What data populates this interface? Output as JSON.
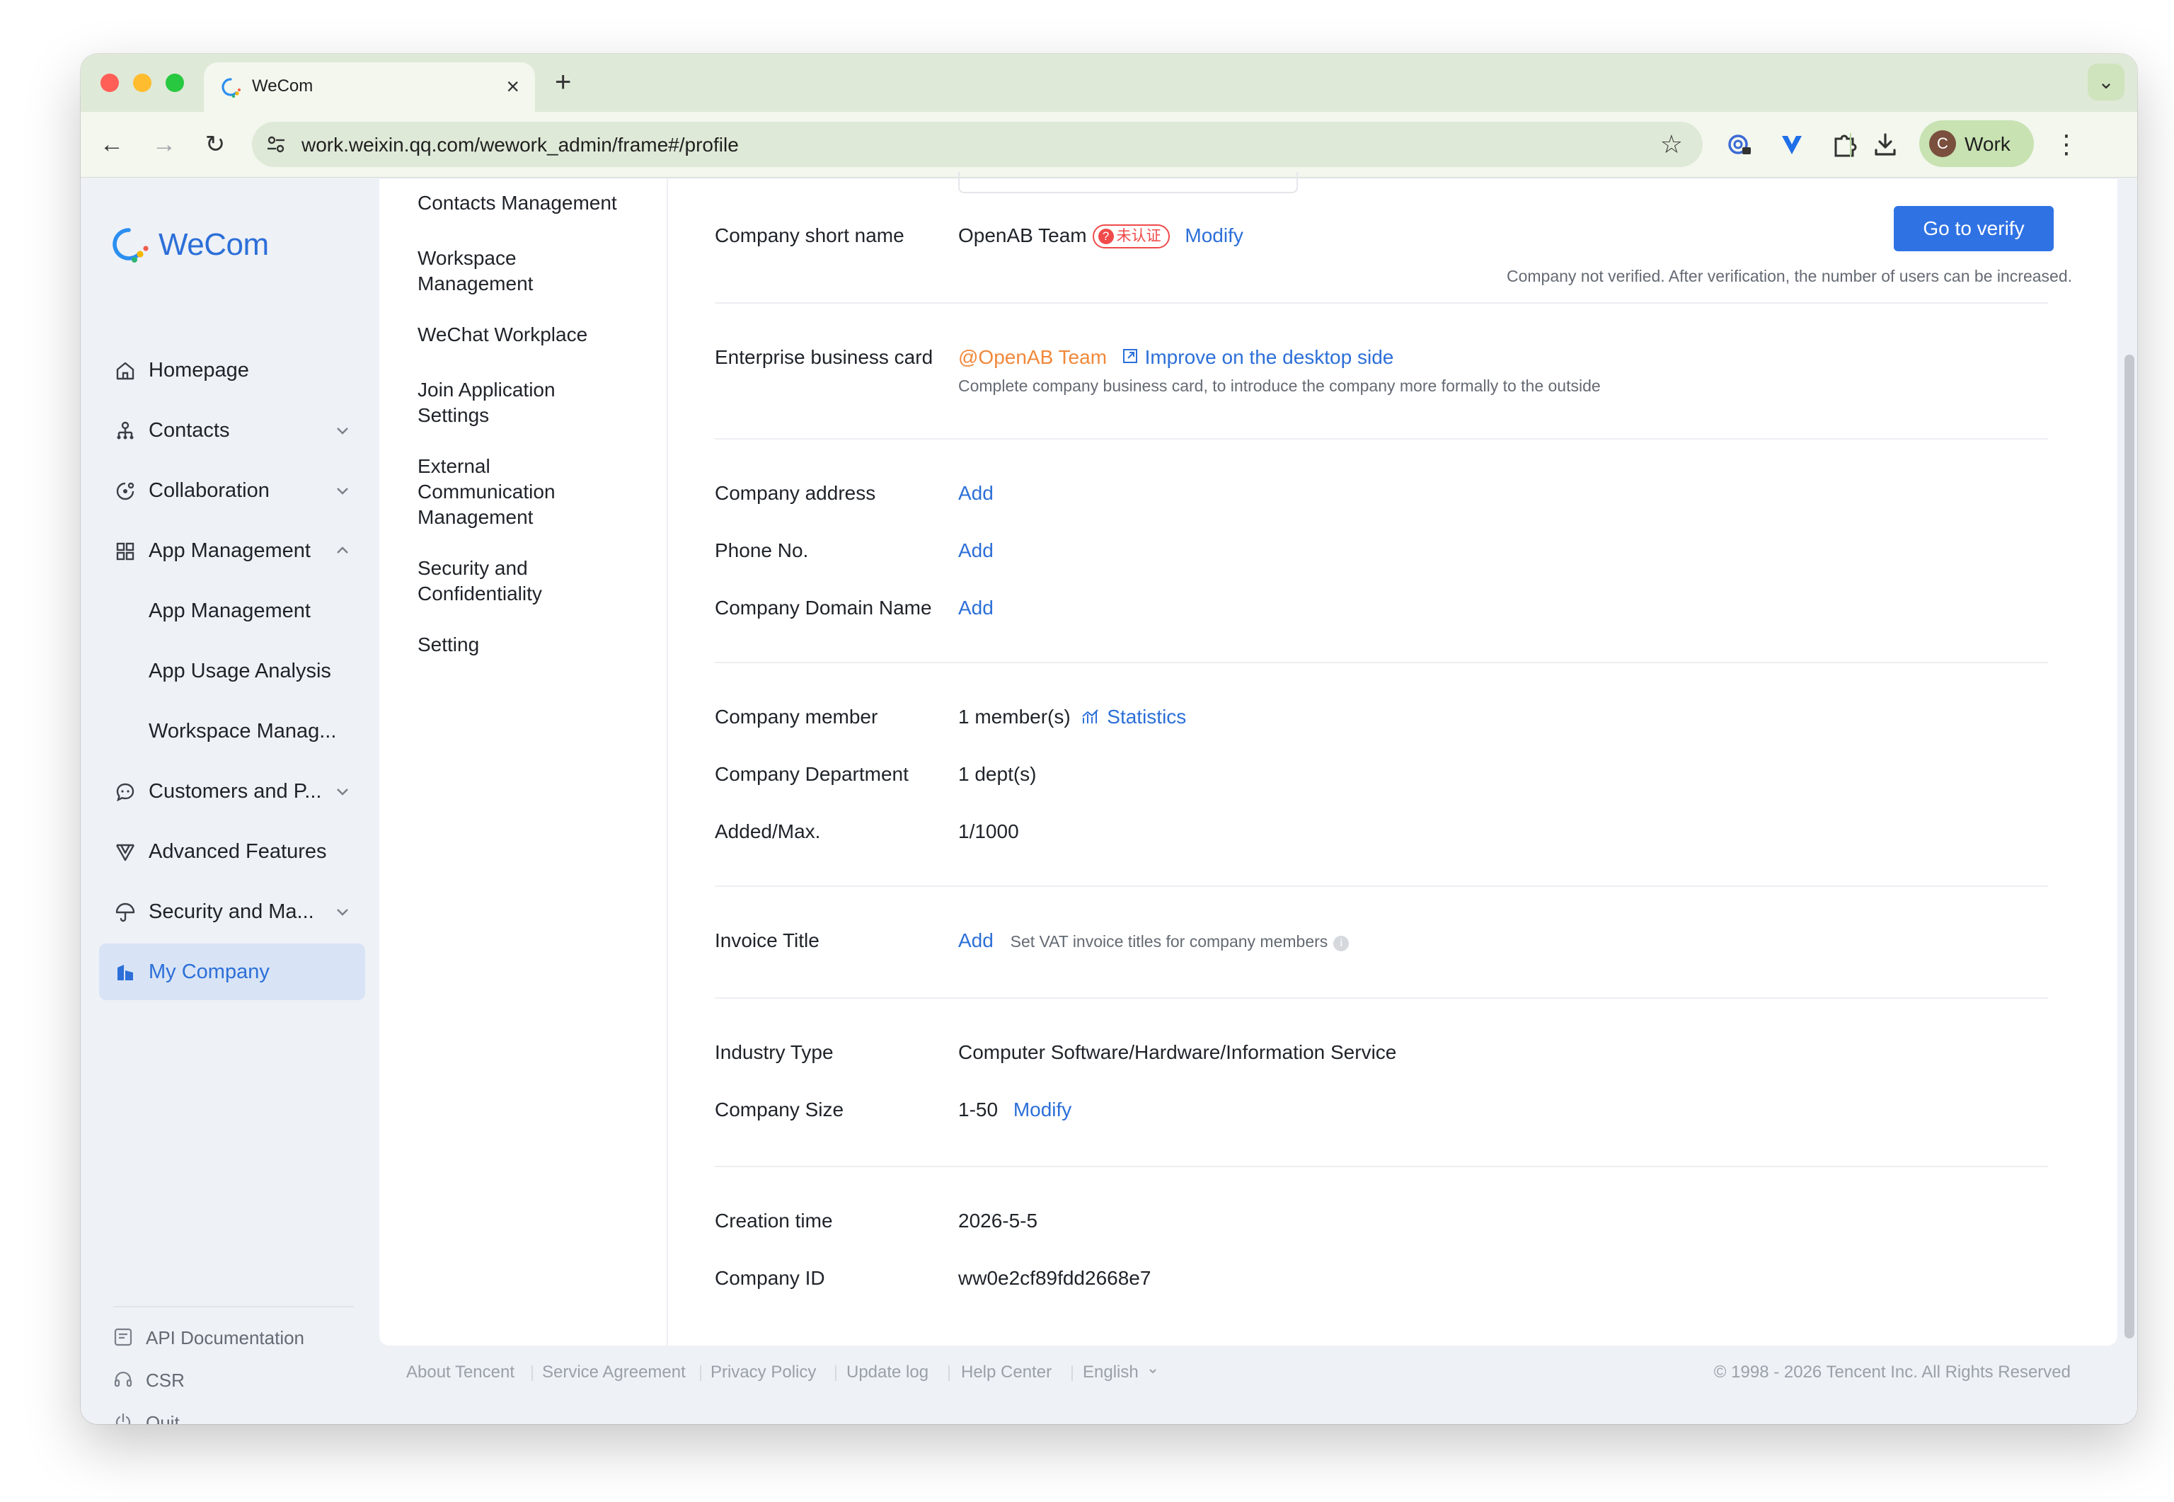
{
  "browser": {
    "tab_title": "WeCom",
    "url": "work.weixin.qq.com/wework_admin/frame#/profile",
    "profile_initial": "C",
    "profile_label": "Work"
  },
  "sidebar": {
    "brand": "WeCom",
    "items": [
      {
        "label": "Homepage",
        "icon": "home-icon"
      },
      {
        "label": "Contacts",
        "icon": "org-chart-icon"
      },
      {
        "label": "Collaboration",
        "icon": "collaboration-icon"
      },
      {
        "label": "App Management",
        "icon": "grid-icon"
      },
      {
        "label": "App Management"
      },
      {
        "label": "App Usage Analysis"
      },
      {
        "label": "Workspace Manag..."
      },
      {
        "label": "Customers and P...",
        "icon": "chat-bubble-icon"
      },
      {
        "label": "Advanced Features",
        "icon": "advanced-features-icon"
      },
      {
        "label": "Security and Ma...",
        "icon": "umbrella-icon"
      },
      {
        "label": "My Company",
        "icon": "company-icon"
      }
    ],
    "bottom": [
      {
        "label": "API Documentation",
        "icon": "api-doc-icon"
      },
      {
        "label": "CSR",
        "icon": "headset-icon"
      },
      {
        "label": "Quit",
        "icon": "power-icon"
      }
    ]
  },
  "subnav": {
    "items": [
      "Contacts Management",
      "Workspace Management",
      "WeChat Workplace",
      "Join Application Settings",
      "External Communication Management",
      "Security and Confidentiality",
      "Setting"
    ]
  },
  "profile": {
    "verify_button": "Go to verify",
    "verify_hint": "Company not verified. After verification, the number of users can be increased.",
    "short_name": {
      "label": "Company short name",
      "value": "OpenAB Team",
      "badge": "未认证",
      "badge_icon": "?",
      "action": "Modify"
    },
    "business_card": {
      "label": "Enterprise business card",
      "value": "@OpenAB Team",
      "action": "Improve on the desktop side",
      "hint": "Complete company business card, to introduce the company more formally to the outside"
    },
    "address": {
      "label": "Company address",
      "action": "Add"
    },
    "phone": {
      "label": "Phone No.",
      "action": "Add"
    },
    "domain": {
      "label": "Company Domain Name",
      "action": "Add"
    },
    "members": {
      "label": "Company member",
      "value": "1 member(s)",
      "action": "Statistics"
    },
    "department": {
      "label": "Company Department",
      "value": "1 dept(s)"
    },
    "added_max": {
      "label": "Added/Max.",
      "value": "1/1000"
    },
    "invoice": {
      "label": "Invoice Title",
      "action": "Add",
      "hint": "Set VAT invoice titles for company members",
      "info_icon": "i"
    },
    "industry": {
      "label": "Industry Type",
      "value": "Computer Software/Hardware/Information Service"
    },
    "size": {
      "label": "Company Size",
      "value": "1-50",
      "action": "Modify"
    },
    "created": {
      "label": "Creation time",
      "value": "2026-5-5"
    },
    "company_id": {
      "label": "Company ID",
      "value": "ww0e2cf89fdd2668e7"
    }
  },
  "footer": {
    "links": [
      "About Tencent",
      "Service Agreement",
      "Privacy Policy",
      "Update log",
      "Help Center",
      "English"
    ],
    "copyright": "© 1998 - 2026 Tencent Inc. All Rights Reserved"
  },
  "colors": {
    "accent": "#2c6fd8",
    "verify_button": "#2f72e4",
    "badge_red": "#f04a4a",
    "orange_name": "#f0883a"
  }
}
